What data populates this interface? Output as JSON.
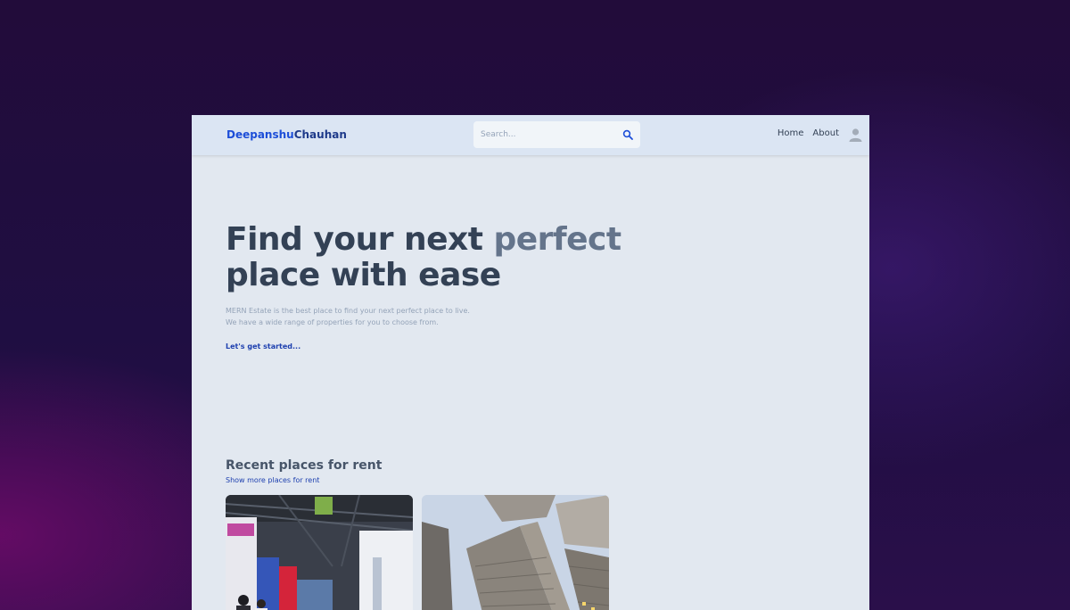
{
  "header": {
    "logo_first": "Deepanshu",
    "logo_second": "Chauhan",
    "search_placeholder": "Search...",
    "nav": [
      {
        "label": "Home"
      },
      {
        "label": "About"
      }
    ]
  },
  "hero": {
    "title_part1": "Find your next ",
    "title_accent": "perfect",
    "title_part2": "place with ease",
    "subtitle_line1": "MERN Estate is the best place to find your next perfect place to live.",
    "subtitle_line2": "We have a wide range of properties for you to choose from.",
    "cta": "Let's get started..."
  },
  "recent": {
    "title": "Recent places for rent",
    "link": "Show more places for rent"
  },
  "colors": {
    "brand": "#1d4ed8",
    "brand_dark": "#1e3a8a",
    "heading": "#334155",
    "accent": "#64748b",
    "page_bg": "#e2e8f0",
    "header_bg": "#dbe5f3"
  },
  "icons": {
    "search": "search-icon",
    "avatar": "user-avatar-icon"
  }
}
